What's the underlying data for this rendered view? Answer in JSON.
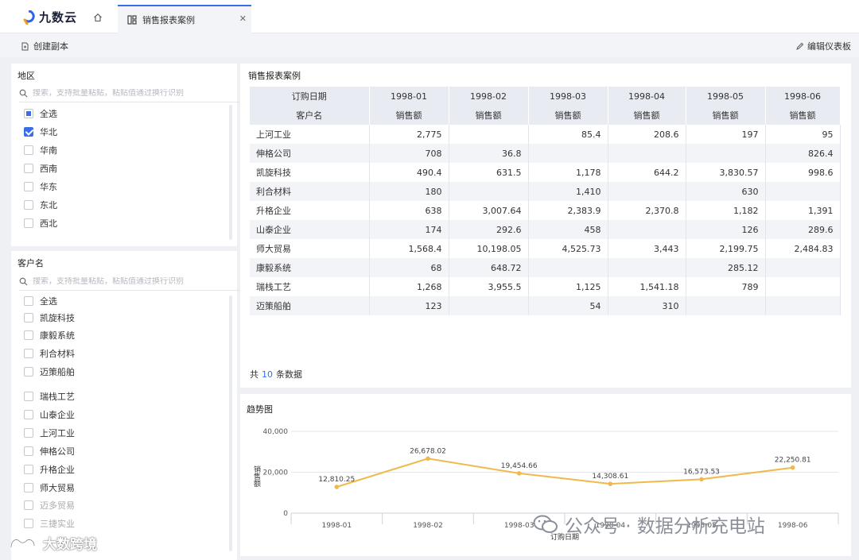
{
  "app": {
    "logo_text": "九数云"
  },
  "tabs": {
    "active_label": "销售报表案例"
  },
  "toolbar": {
    "copy_label": "创建副本",
    "edit_label": "编辑仪表板"
  },
  "region_filter": {
    "title": "地区",
    "search_placeholder": "搜索，支持批量粘贴，粘贴值通过换行识别",
    "options": [
      {
        "label": "全选",
        "state": "partial"
      },
      {
        "label": "华北",
        "state": "checked"
      },
      {
        "label": "华南",
        "state": "unchecked"
      },
      {
        "label": "西南",
        "state": "unchecked"
      },
      {
        "label": "华东",
        "state": "unchecked"
      },
      {
        "label": "东北",
        "state": "unchecked"
      },
      {
        "label": "西北",
        "state": "unchecked"
      }
    ]
  },
  "customer_filter": {
    "title": "客户名",
    "search_placeholder": "搜索，支持批量粘贴，粘贴值通过换行识别",
    "options": [
      {
        "label": "全选"
      },
      {
        "label": "凯旋科技"
      },
      {
        "label": "康毅系统"
      },
      {
        "label": "利合材料"
      },
      {
        "label": "迈策船舶"
      },
      {
        "label": "瑞栈工艺"
      },
      {
        "label": "山泰企业"
      },
      {
        "label": "上河工业"
      },
      {
        "label": "伸格公司"
      },
      {
        "label": "升格企业"
      },
      {
        "label": "师大贸易"
      },
      {
        "label": "迈多贸易"
      },
      {
        "label": "三捷实业"
      }
    ]
  },
  "report": {
    "title": "销售报表案例",
    "header_row1_label": "订购日期",
    "header_row2_label": "客户名",
    "months": [
      "1998-01",
      "1998-02",
      "1998-03",
      "1998-04",
      "1998-05",
      "1998-06"
    ],
    "measure_label": "销售额",
    "rows": [
      {
        "name": "上河工业",
        "values": [
          "2,775",
          "",
          "85.4",
          "208.6",
          "197",
          "95"
        ]
      },
      {
        "name": "伸格公司",
        "values": [
          "708",
          "36.8",
          "",
          "",
          "",
          "826.4"
        ]
      },
      {
        "name": "凯旋科技",
        "values": [
          "490.4",
          "631.5",
          "1,178",
          "644.2",
          "3,830.57",
          "998.6"
        ]
      },
      {
        "name": "利合材料",
        "values": [
          "180",
          "",
          "1,410",
          "",
          "630",
          ""
        ]
      },
      {
        "name": "升格企业",
        "values": [
          "638",
          "3,007.64",
          "2,383.9",
          "2,370.8",
          "1,182",
          "1,391"
        ]
      },
      {
        "name": "山泰企业",
        "values": [
          "174",
          "292.6",
          "458",
          "",
          "126",
          "289.6"
        ]
      },
      {
        "name": "师大贸易",
        "values": [
          "1,568.4",
          "10,198.05",
          "4,525.73",
          "3,443",
          "2,199.75",
          "2,484.83"
        ]
      },
      {
        "name": "康毅系统",
        "values": [
          "68",
          "648.72",
          "",
          "",
          "285.12",
          ""
        ]
      },
      {
        "name": "瑞栈工艺",
        "values": [
          "1,268",
          "3,955.5",
          "1,125",
          "1,541.18",
          "789",
          ""
        ]
      },
      {
        "name": "迈策船舶",
        "values": [
          "123",
          "",
          "54",
          "310",
          "",
          ""
        ]
      }
    ],
    "count_prefix": "共",
    "count_value": "10",
    "count_suffix": "条数据"
  },
  "chart_data": {
    "type": "line",
    "title": "趋势图",
    "xlabel": "订购日期",
    "ylabel": "销售额",
    "categories": [
      "1998-01",
      "1998-02",
      "1998-03",
      "1998-04",
      "1998-05",
      "1998-06"
    ],
    "values": [
      12810.25,
      26678.02,
      19454.66,
      14308.61,
      16573.53,
      22250.81
    ],
    "data_labels": [
      "12,810.25",
      "26,678.02",
      "19,454.66",
      "14,308.61",
      "16,573.53",
      "22,250.81"
    ],
    "y_ticks": [
      0,
      20000,
      40000
    ],
    "y_tick_labels": [
      "0",
      "20,000",
      "40,000"
    ],
    "ylim": [
      0,
      40000
    ],
    "line_color": "#f0b94a",
    "grid": true
  },
  "watermarks": {
    "wechat": "公众号 · 数据分析充电站",
    "brand": "大数跨境"
  }
}
